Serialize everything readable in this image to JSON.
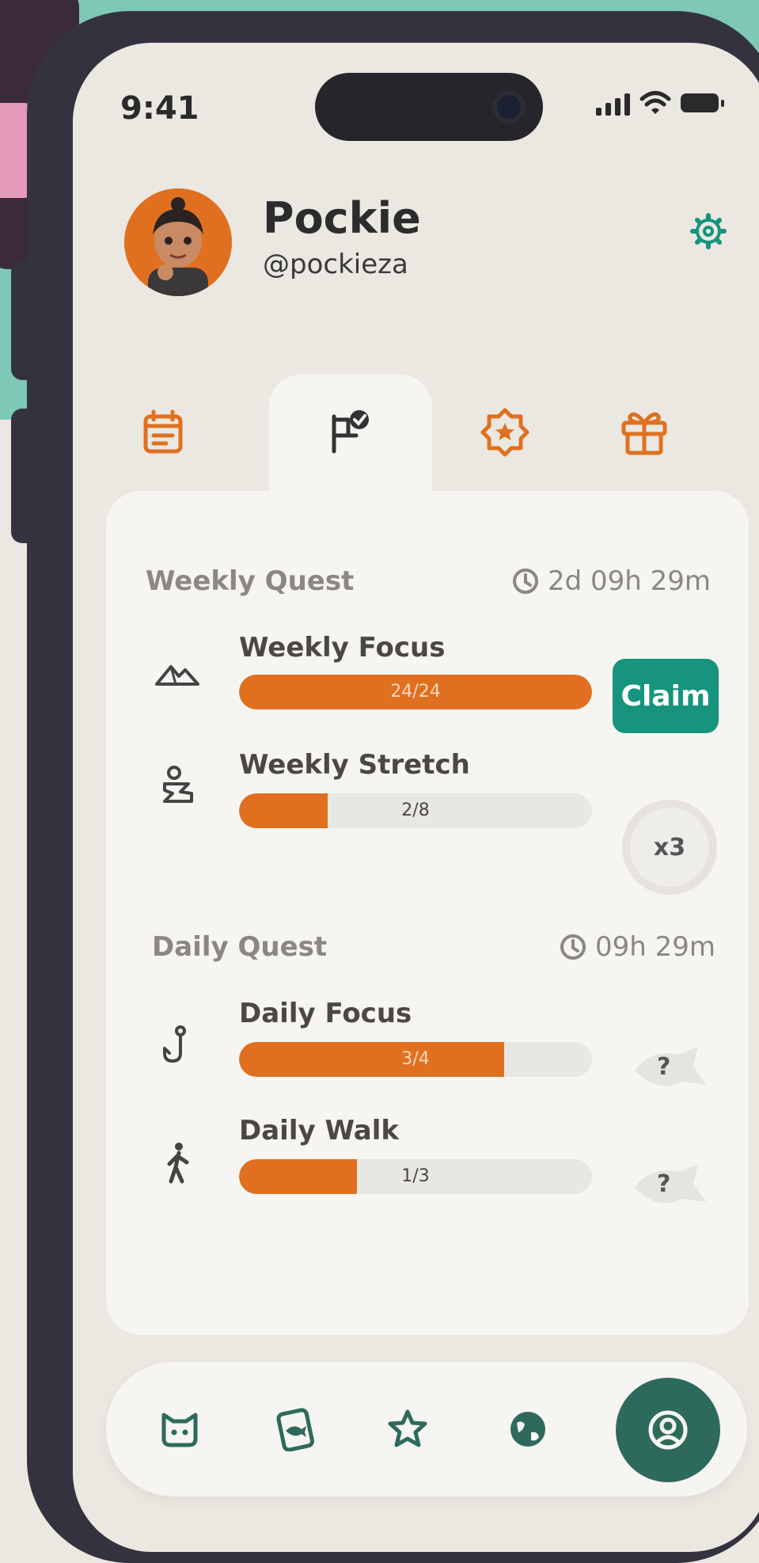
{
  "status": {
    "time": "9:41"
  },
  "profile": {
    "name": "Pockie",
    "handle": "@pockieza"
  },
  "tabs": [
    {
      "icon": "calendar-icon"
    },
    {
      "icon": "flag-check-icon",
      "active": true
    },
    {
      "icon": "star-badge-icon"
    },
    {
      "icon": "gift-icon"
    }
  ],
  "weekly": {
    "title": "Weekly Quest",
    "timer": "2d 09h 29m",
    "quests": [
      {
        "name": "Weekly Focus",
        "progress": "24/24",
        "fraction": 1.0,
        "action": "Claim"
      },
      {
        "name": "Weekly Stretch",
        "progress": "2/8",
        "fraction": 0.25,
        "reward": "x3"
      }
    ]
  },
  "daily": {
    "title": "Daily Quest",
    "timer": "09h 29m",
    "quests": [
      {
        "name": "Daily Focus",
        "progress": "3/4",
        "fraction": 0.75,
        "reward": "?"
      },
      {
        "name": "Daily Walk",
        "progress": "1/3",
        "fraction": 0.333,
        "reward": "?"
      }
    ]
  },
  "nav": [
    {
      "icon": "cat-icon"
    },
    {
      "icon": "fish-card-icon"
    },
    {
      "icon": "star-icon"
    },
    {
      "icon": "globe-icon"
    },
    {
      "icon": "profile-icon",
      "active": true
    }
  ],
  "colors": {
    "accent": "#e0701f",
    "claim": "#16947e",
    "nav_active": "#2e6a5c",
    "background": "#ebe8e2",
    "card": "#f6f5f2"
  }
}
